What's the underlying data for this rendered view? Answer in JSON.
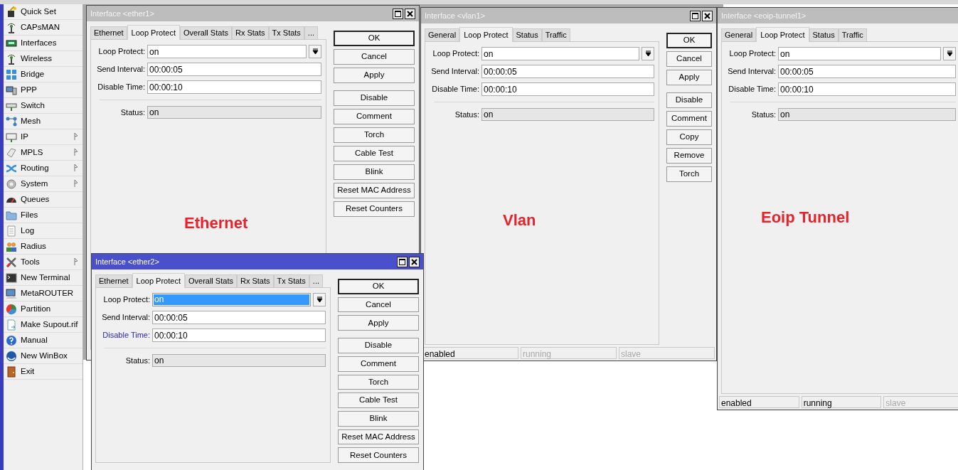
{
  "sidebar": {
    "items": [
      {
        "label": "Quick Set",
        "has_submenu": false
      },
      {
        "label": "CAPsMAN",
        "has_submenu": false
      },
      {
        "label": "Interfaces",
        "has_submenu": false
      },
      {
        "label": "Wireless",
        "has_submenu": false
      },
      {
        "label": "Bridge",
        "has_submenu": false
      },
      {
        "label": "PPP",
        "has_submenu": false
      },
      {
        "label": "Switch",
        "has_submenu": false
      },
      {
        "label": "Mesh",
        "has_submenu": false
      },
      {
        "label": "IP",
        "has_submenu": true
      },
      {
        "label": "MPLS",
        "has_submenu": true
      },
      {
        "label": "Routing",
        "has_submenu": true
      },
      {
        "label": "System",
        "has_submenu": true
      },
      {
        "label": "Queues",
        "has_submenu": false
      },
      {
        "label": "Files",
        "has_submenu": false
      },
      {
        "label": "Log",
        "has_submenu": false
      },
      {
        "label": "Radius",
        "has_submenu": false
      },
      {
        "label": "Tools",
        "has_submenu": true
      },
      {
        "label": "New Terminal",
        "has_submenu": false
      },
      {
        "label": "MetaROUTER",
        "has_submenu": false
      },
      {
        "label": "Partition",
        "has_submenu": false
      },
      {
        "label": "Make Supout.rif",
        "has_submenu": false
      },
      {
        "label": "Manual",
        "has_submenu": false
      },
      {
        "label": "New WinBox",
        "has_submenu": false
      },
      {
        "label": "Exit",
        "has_submenu": false
      }
    ]
  },
  "windows": [
    {
      "title": "Interface <ether1>",
      "active": false,
      "tabs": [
        {
          "label": "Ethernet",
          "selected": false
        },
        {
          "label": "Loop Protect",
          "selected": true
        },
        {
          "label": "Overall Stats",
          "selected": false
        },
        {
          "label": "Rx Stats",
          "selected": false
        },
        {
          "label": "Tx Stats",
          "selected": false
        },
        {
          "label": "...",
          "selected": false
        }
      ],
      "fields": [
        {
          "kind": "dropdown",
          "label": "Loop Protect:",
          "value": "on",
          "selected": false,
          "modified": false
        },
        {
          "kind": "text",
          "label": "Send Interval:",
          "value": "00:00:05",
          "selected": false,
          "modified": false
        },
        {
          "kind": "text",
          "label": "Disable Time:",
          "value": "00:00:10",
          "selected": false,
          "modified": false
        }
      ],
      "status": {
        "label": "Status:",
        "value": "on"
      },
      "buttons": [
        {
          "label": "OK",
          "default": true
        },
        {
          "label": "Cancel",
          "default": false
        },
        {
          "label": "Apply",
          "default": false
        },
        {
          "label": "Disable",
          "default": false
        },
        {
          "label": "Comment",
          "default": false
        },
        {
          "label": "Torch",
          "default": false
        },
        {
          "label": "Cable Test",
          "default": false
        },
        {
          "label": "Blink",
          "default": false
        },
        {
          "label": "Reset MAC Address",
          "default": false
        },
        {
          "label": "Reset Counters",
          "default": false
        }
      ],
      "annotation": "Ethernet"
    },
    {
      "title": "Interface <vlan1>",
      "active": false,
      "tabs": [
        {
          "label": "General",
          "selected": false
        },
        {
          "label": "Loop Protect",
          "selected": true
        },
        {
          "label": "Status",
          "selected": false
        },
        {
          "label": "Traffic",
          "selected": false
        }
      ],
      "fields": [
        {
          "kind": "dropdown",
          "label": "Loop Protect:",
          "value": "on",
          "selected": false,
          "modified": false
        },
        {
          "kind": "text",
          "label": "Send Interval:",
          "value": "00:00:05",
          "selected": false,
          "modified": false
        },
        {
          "kind": "text",
          "label": "Disable Time:",
          "value": "00:00:10",
          "selected": false,
          "modified": false
        }
      ],
      "status": {
        "label": "Status:",
        "value": "on"
      },
      "buttons": [
        {
          "label": "OK",
          "default": true
        },
        {
          "label": "Cancel",
          "default": false
        },
        {
          "label": "Apply",
          "default": false
        },
        {
          "label": "Disable",
          "default": false
        },
        {
          "label": "Comment",
          "default": false
        },
        {
          "label": "Copy",
          "default": false
        },
        {
          "label": "Remove",
          "default": false
        },
        {
          "label": "Torch",
          "default": false
        }
      ],
      "annotation": "Vlan",
      "status_bar": [
        {
          "text": "enabled",
          "disabled": false
        },
        {
          "text": "running",
          "disabled": true
        },
        {
          "text": "slave",
          "disabled": true
        }
      ]
    },
    {
      "title": "Interface <eoip-tunnel1>",
      "active": false,
      "tabs": [
        {
          "label": "General",
          "selected": false
        },
        {
          "label": "Loop Protect",
          "selected": true
        },
        {
          "label": "Status",
          "selected": false
        },
        {
          "label": "Traffic",
          "selected": false
        }
      ],
      "fields": [
        {
          "kind": "dropdown",
          "label": "Loop Protect:",
          "value": "on",
          "selected": false,
          "modified": false
        },
        {
          "kind": "text",
          "label": "Send Interval:",
          "value": "00:00:05",
          "selected": false,
          "modified": false
        },
        {
          "kind": "text",
          "label": "Disable Time:",
          "value": "00:00:10",
          "selected": false,
          "modified": false
        }
      ],
      "status": {
        "label": "Status:",
        "value": "on"
      },
      "annotation": "Eoip Tunnel",
      "status_bar": [
        {
          "text": "enabled",
          "disabled": false
        },
        {
          "text": "running",
          "disabled": false
        },
        {
          "text": "slave",
          "disabled": true
        }
      ]
    },
    {
      "title": "Interface <ether2>",
      "active": true,
      "tabs": [
        {
          "label": "Ethernet",
          "selected": false
        },
        {
          "label": "Loop Protect",
          "selected": true
        },
        {
          "label": "Overall Stats",
          "selected": false
        },
        {
          "label": "Rx Stats",
          "selected": false
        },
        {
          "label": "Tx Stats",
          "selected": false
        },
        {
          "label": "...",
          "selected": false
        }
      ],
      "fields": [
        {
          "kind": "dropdown",
          "label": "Loop Protect:",
          "value": "on",
          "selected": true,
          "modified": false
        },
        {
          "kind": "text",
          "label": "Send Interval:",
          "value": "00:00:05",
          "selected": false,
          "modified": false
        },
        {
          "kind": "text",
          "label": "Disable Time:",
          "value": "00:00:10",
          "selected": false,
          "modified": true
        }
      ],
      "status": {
        "label": "Status:",
        "value": "on"
      },
      "buttons": [
        {
          "label": "OK",
          "default": true
        },
        {
          "label": "Cancel",
          "default": false
        },
        {
          "label": "Apply",
          "default": false
        },
        {
          "label": "Disable",
          "default": false
        },
        {
          "label": "Comment",
          "default": false
        },
        {
          "label": "Torch",
          "default": false
        },
        {
          "label": "Cable Test",
          "default": false
        },
        {
          "label": "Blink",
          "default": false
        },
        {
          "label": "Reset MAC Address",
          "default": false
        },
        {
          "label": "Reset Counters",
          "default": false
        }
      ]
    }
  ]
}
